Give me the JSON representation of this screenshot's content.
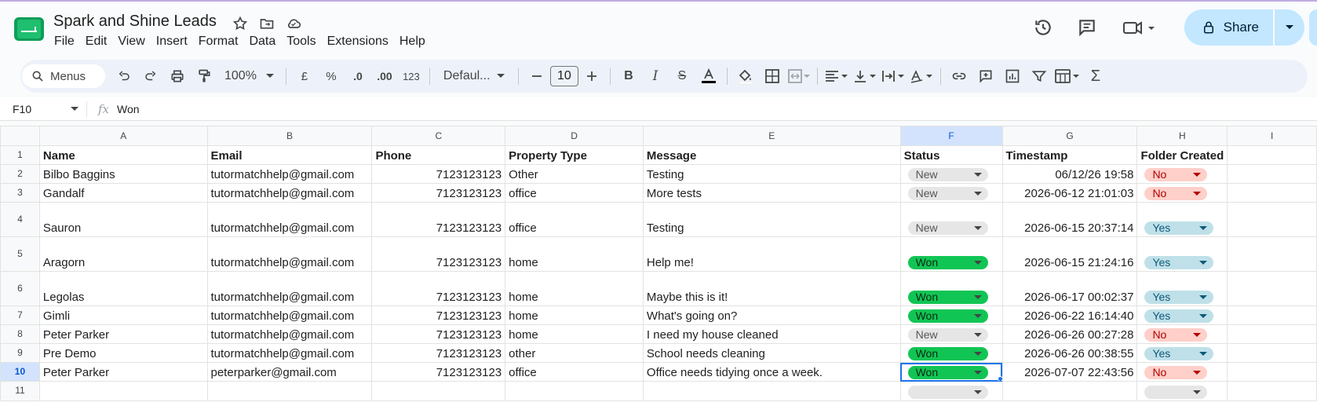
{
  "app": {
    "doc_title": "Spark and Shine Leads",
    "menu": [
      "File",
      "Edit",
      "View",
      "Insert",
      "Format",
      "Data",
      "Tools",
      "Extensions",
      "Help"
    ],
    "share_label": "Share",
    "colors": {
      "accent": "#0b57d0",
      "share_bg": "#c2e7ff",
      "won": "#11c554",
      "yes": "#bfe0e9",
      "no": "#ffcfc9"
    }
  },
  "toolbar": {
    "menus_label": "Menus",
    "zoom": "100%",
    "currency": "£",
    "percent": "%",
    "dec_minus": ".0",
    "dec_plus": ".00",
    "number_fmt": "123",
    "font": "Defaul...",
    "font_size": "10"
  },
  "formula_bar": {
    "cell_ref": "F10",
    "value": "Won"
  },
  "grid": {
    "columns": [
      "A",
      "B",
      "C",
      "D",
      "E",
      "F",
      "G",
      "H",
      "I"
    ],
    "header_row": [
      "Name",
      "Email",
      "Phone",
      "Property Type",
      "Message",
      "Status",
      "Timestamp",
      "Folder Created"
    ],
    "rows": [
      {
        "n": "2",
        "name": "Bilbo Baggins",
        "email": "tutormatchhelp@gmail.com",
        "phone": "7123123123",
        "type": "Other",
        "message": "Testing",
        "status": "New",
        "timestamp": "06/12/26 19:58",
        "folder": "No"
      },
      {
        "n": "3",
        "name": "Gandalf",
        "email": "tutormatchhelp@gmail.com",
        "phone": "7123123123",
        "type": "office",
        "message": "More tests",
        "status": "New",
        "timestamp": "2026-06-12 21:01:03",
        "folder": "No"
      },
      {
        "n": "4",
        "name": "Sauron",
        "email": "tutormatchhelp@gmail.com",
        "phone": "7123123123",
        "type": "office",
        "message": "Testing",
        "status": "New",
        "timestamp": "2026-06-15 20:37:14",
        "folder": "Yes"
      },
      {
        "n": "5",
        "name": "Aragorn",
        "email": "tutormatchhelp@gmail.com",
        "phone": "7123123123",
        "type": "home",
        "message": "Help me!",
        "status": "Won",
        "timestamp": "2026-06-15 21:24:16",
        "folder": "Yes"
      },
      {
        "n": "6",
        "name": "Legolas",
        "email": "tutormatchhelp@gmail.com",
        "phone": "7123123123",
        "type": "home",
        "message": "Maybe this is it!",
        "status": "Won",
        "timestamp": "2026-06-17 00:02:37",
        "folder": "Yes"
      },
      {
        "n": "7",
        "name": "Gimli",
        "email": "tutormatchhelp@gmail.com",
        "phone": "7123123123",
        "type": "home",
        "message": "What's going on?",
        "status": "Won",
        "timestamp": "2026-06-22 16:14:40",
        "folder": "Yes"
      },
      {
        "n": "8",
        "name": "Peter Parker",
        "email": "tutormatchhelp@gmail.com",
        "phone": "7123123123",
        "type": "home",
        "message": "I need my house cleaned",
        "status": "New",
        "timestamp": "2026-06-26 00:27:28",
        "folder": "No"
      },
      {
        "n": "9",
        "name": "Pre Demo",
        "email": "tutormatchhelp@gmail.com",
        "phone": "7123123123",
        "type": "other",
        "message": "School needs cleaning",
        "status": "Won",
        "timestamp": "2026-06-26 00:38:55",
        "folder": "Yes"
      },
      {
        "n": "10",
        "name": "Peter Parker",
        "email": "peterparker@gmail.com",
        "phone": "7123123123",
        "type": "office",
        "message": "Office needs tidying once a week.",
        "status": "Won",
        "timestamp": "2026-07-07 22:43:56",
        "folder": "No"
      },
      {
        "n": "11",
        "name": "",
        "email": "",
        "phone": "",
        "type": "",
        "message": "",
        "status": "",
        "timestamp": "",
        "folder": ""
      }
    ]
  }
}
